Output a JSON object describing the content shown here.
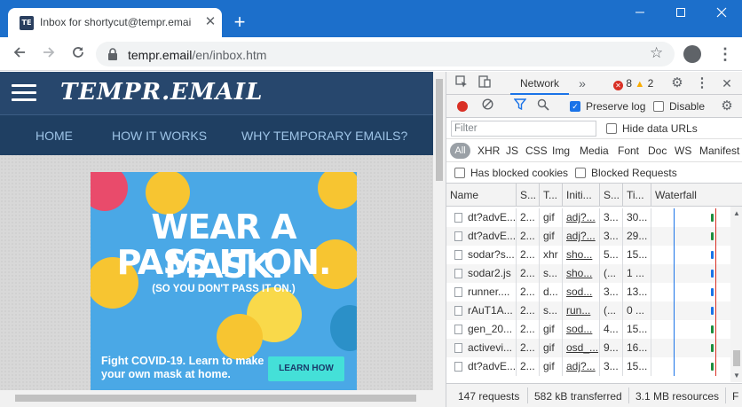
{
  "browser": {
    "tab_title": "Inbox for shortycut@tempr.emai",
    "tab_favicon_text": "TE",
    "new_tab": "+",
    "url_host": "tempr.email",
    "url_path": "/en/inbox.htm"
  },
  "site": {
    "logo": "TEMPR.EMAIL",
    "nav": [
      "HOME",
      "HOW IT WORKS",
      "WHY TEMPORARY EMAILS?"
    ]
  },
  "ad": {
    "line1": "WEAR A MASK.",
    "line2": "PASS IT ON.",
    "sub": "(SO YOU DON'T PASS IT ON.)",
    "footer": "Fight COVID-19. Learn to make your own mask at home.",
    "button": "LEARN HOW"
  },
  "devtools": {
    "tab_network": "Network",
    "more_tabs": "»",
    "errors": "8",
    "warnings": "2",
    "preserve_log": "Preserve log",
    "disable_cache": "Disable",
    "filter_placeholder": "Filter",
    "hide_data_urls": "Hide data URLs",
    "types": [
      "All",
      "XHR",
      "JS",
      "CSS",
      "Img",
      "Media",
      "Font",
      "Doc",
      "WS",
      "Manifest"
    ],
    "has_blocked_cookies": "Has blocked cookies",
    "blocked_requests": "Blocked Requests",
    "columns": [
      "Name",
      "S...",
      "T...",
      "Initi...",
      "S...",
      "Ti...",
      "Waterfall"
    ],
    "rows": [
      {
        "name": "dt?advE...",
        "status": "2...",
        "type": "gif",
        "initiator": "adj?...",
        "size": "3...",
        "time": "30...",
        "wf_color": "#1e8e3e"
      },
      {
        "name": "dt?advE...",
        "status": "2...",
        "type": "gif",
        "initiator": "adj?...",
        "size": "3...",
        "time": "29...",
        "wf_color": "#1e8e3e"
      },
      {
        "name": "sodar?s...",
        "status": "2...",
        "type": "xhr",
        "initiator": "sho...",
        "size": "5...",
        "time": "15...",
        "wf_color": "#1a73e8"
      },
      {
        "name": "sodar2.js",
        "status": "2...",
        "type": "s...",
        "initiator": "sho...",
        "size": "(...",
        "time": "1 ...",
        "wf_color": "#1a73e8"
      },
      {
        "name": "runner....",
        "status": "2...",
        "type": "d...",
        "initiator": "sod...",
        "size": "3...",
        "time": "13...",
        "wf_color": "#1a73e8"
      },
      {
        "name": "rAuT1A...",
        "status": "2...",
        "type": "s...",
        "initiator": "run...",
        "size": "(...",
        "time": "0 ...",
        "wf_color": "#1a73e8"
      },
      {
        "name": "gen_20...",
        "status": "2...",
        "type": "gif",
        "initiator": "sod...",
        "size": "4...",
        "time": "15...",
        "wf_color": "#1e8e3e"
      },
      {
        "name": "activevi...",
        "status": "2...",
        "type": "gif",
        "initiator": "osd_...",
        "size": "9...",
        "time": "16...",
        "wf_color": "#1e8e3e"
      },
      {
        "name": "dt?advE...",
        "status": "2...",
        "type": "gif",
        "initiator": "adj?...",
        "size": "3...",
        "time": "15...",
        "wf_color": "#1e8e3e"
      }
    ],
    "status_requests": "147 requests",
    "status_transferred": "582 kB transferred",
    "status_resources": "3.1 MB resources",
    "status_more": "F"
  }
}
